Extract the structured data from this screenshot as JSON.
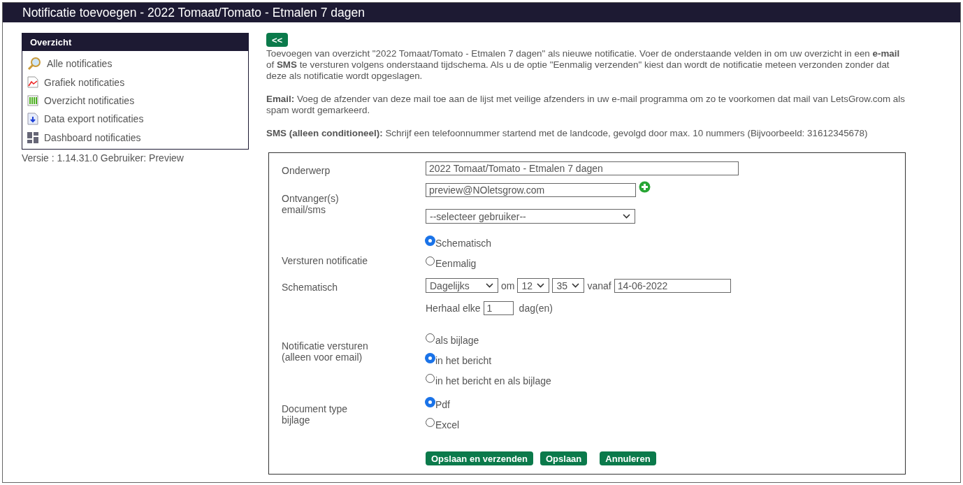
{
  "title": "Notificatie toevoegen  -  2022 Tomaat/Tomato - Etmalen 7 dagen",
  "sidebar": {
    "heading": "Overzicht",
    "items": [
      {
        "label": "Alle notificaties"
      },
      {
        "label": "Grafiek notificaties"
      },
      {
        "label": "Overzicht notificaties"
      },
      {
        "label": "Data export notificaties"
      },
      {
        "label": "Dashboard notificaties"
      }
    ],
    "version": "Versie : 1.14.31.0 Gebruiker: Preview"
  },
  "back_button": "<<",
  "paragraphs": [
    "Toevoegen van overzicht \"2022 Tomaat/Tomato - Etmalen 7 dagen\" als nieuwe notificatie. Voer de onderstaande velden in om uw overzicht in een **e-mail** of **SMS** te versturen volgens onderstaand tijdschema. Als u de optie \"Eenmalig verzenden\" kiest dan wordt de notificatie meteen verzonden zonder dat deze als notificatie wordt opgeslagen.",
    "**Email:** Voeg de afzender van deze mail toe aan de lijst met veilige afzenders in uw e-mail programma om zo te voorkomen dat mail van LetsGrow.com als spam wordt gemarkeerd.",
    "**SMS (alleen conditioneel):** Schrijf een telefoonnummer startend met de landcode, gevolgd door max. 10 nummers (Bijvoorbeeld: 31612345678)"
  ],
  "form": {
    "subject": {
      "label": "Onderwerp",
      "value": "2022 Tomaat/Tomato - Etmalen 7 dagen"
    },
    "recipients": {
      "label": "Ontvanger(s)\nemail/sms",
      "email": "preview@NOletsgrow.com",
      "select": "--selecteer gebruiker--"
    },
    "sending": {
      "label": "Versturen notificatie",
      "options": [
        {
          "label": "Schematisch",
          "selected": true
        },
        {
          "label": "Eenmalig",
          "selected": false
        }
      ]
    },
    "schedule": {
      "label": "Schematisch",
      "frequency": "Dagelijks",
      "om": "om",
      "hour": "12",
      "minute": "35",
      "vanaf": "vanaf",
      "date": "14-06-2022",
      "repeat_label": "Herhaal elke",
      "repeat_value": "1",
      "repeat_unit": "dag(en)"
    },
    "delivery": {
      "label": "Notificatie versturen\n(alleen voor email)",
      "options": [
        {
          "label": "als bijlage",
          "selected": false
        },
        {
          "label": "in het bericht",
          "selected": true
        },
        {
          "label": "in het bericht en als bijlage",
          "selected": false
        }
      ]
    },
    "doc_type": {
      "label": "Document type\nbijlage",
      "options": [
        {
          "label": "Pdf",
          "selected": true
        },
        {
          "label": "Excel",
          "selected": false
        }
      ]
    }
  },
  "buttons": [
    "Opslaan en verzenden",
    "Opslaan",
    "Annuleren"
  ]
}
